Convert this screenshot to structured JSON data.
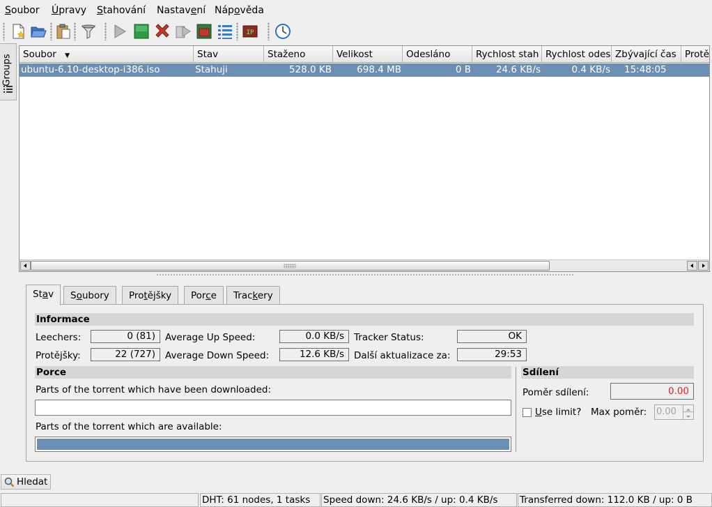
{
  "menu": [
    {
      "pre": "",
      "u": "S",
      "post": "oubor"
    },
    {
      "pre": "",
      "u": "Ú",
      "post": "pravy"
    },
    {
      "pre": "",
      "u": "S",
      "post": "tahování"
    },
    {
      "pre": "Nastav",
      "u": "e",
      "post": "ní"
    },
    {
      "pre": "Náp",
      "u": "o",
      "post": "věda"
    }
  ],
  "toolbar_icons": [
    "new-torrent-icon",
    "open-folder-icon",
    "paste-icon",
    "filter-icon",
    "start-icon",
    "stop-icon",
    "remove-icon",
    "queue-icon",
    "settings-window-icon",
    "list-view-icon",
    "ip-filter-icon",
    "scheduler-clock-icon"
  ],
  "groups_tab": {
    "label": "Groups"
  },
  "table": {
    "columns": [
      "Soubor",
      "Stav",
      "Staženo",
      "Velikost",
      "Odesláno",
      "Rychlost stah",
      "Rychlost odes",
      "Zbývající čas",
      "Protě"
    ],
    "sort_indicator": "▼",
    "rows": [
      {
        "soubor": "ubuntu-6.10-desktop-i386.iso",
        "stav": "Stahuji",
        "stazeno": "528.0 KB",
        "velikost": "698.4 MB",
        "odeslano": "0 B",
        "rychlost_stah": "24.6 KB/s",
        "rychlost_odes": "0.4 KB/s",
        "zbyvajici": "15:48:05"
      }
    ]
  },
  "tabs": [
    {
      "pre": "St",
      "u": "a",
      "post": "v"
    },
    {
      "pre": "S",
      "u": "o",
      "post": "ubory"
    },
    {
      "pre": "Pro",
      "u": "t",
      "post": "ějšky"
    },
    {
      "pre": "Por",
      "u": "c",
      "post": "e"
    },
    {
      "pre": "Trac",
      "u": "k",
      "post": "ery"
    }
  ],
  "info": {
    "header": "Informace",
    "leechers_label": "Leechers:",
    "leechers_value": "0 (81)",
    "peers_label": "Protějšky:",
    "peers_value": "22 (727)",
    "avg_up_label": "Average Up Speed:",
    "avg_up_value": "0.0 KB/s",
    "avg_down_label": "Average Down Speed:",
    "avg_down_value": "12.6 KB/s",
    "tracker_status_label": "Tracker Status:",
    "tracker_status_value": "OK",
    "next_update_label": "Další aktualizace za:",
    "next_update_value": "29:53"
  },
  "pieces": {
    "header": "Porce",
    "downloaded_label": "Parts of the torrent which have been downloaded:",
    "available_label": "Parts of the torrent which are available:",
    "downloaded_fraction": 0.0,
    "available_fraction": 1.0
  },
  "sharing": {
    "header": "Sdílení",
    "ratio_label": "Poměr sdílení:",
    "ratio_value": "0.00",
    "use_limit_pre": "",
    "use_limit_u": "U",
    "use_limit_post": "se limit?",
    "use_limit_checked": false,
    "max_ratio_label": "Max poměr:",
    "max_ratio_value": "0.00"
  },
  "search_button": "Hledat",
  "status": {
    "blank": "",
    "dht": "DHT: 61 nodes, 1 tasks",
    "speed": "Speed down: 24.6 KB/s / up: 0.4 KB/s",
    "transferred": "Transferred down: 112.0 KB / up: 0 B"
  },
  "colors": {
    "selection": "#6b8eb5",
    "pieces_bar": "#6b8eb5",
    "ratio_text": "#e02020"
  }
}
